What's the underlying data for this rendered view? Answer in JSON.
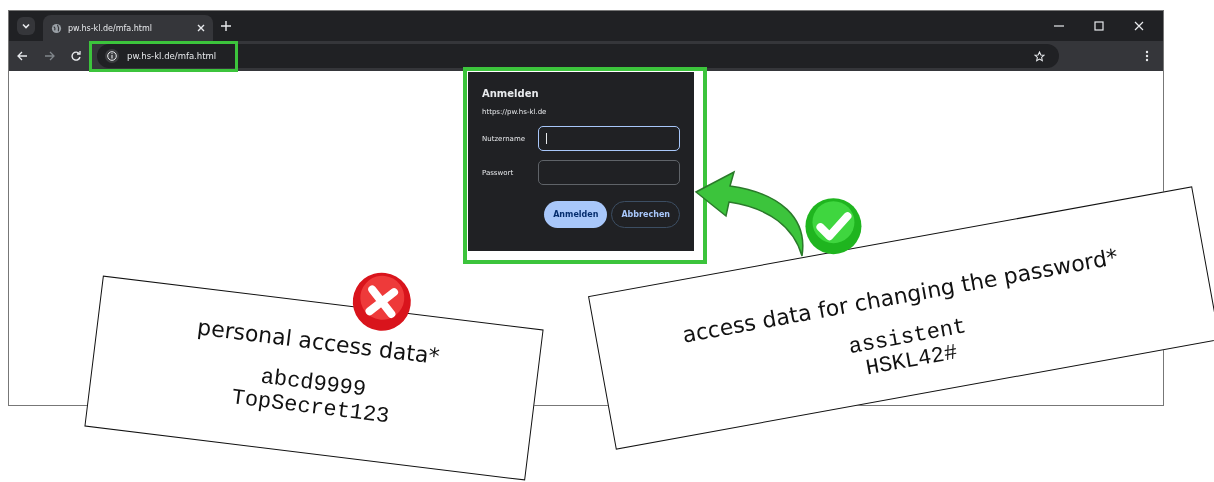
{
  "browser": {
    "tab": {
      "title": "pw.hs-kl.de/mfa.html"
    },
    "address": "pw.hs-kl.de/mfa.html"
  },
  "dialog": {
    "title": "Anmelden",
    "origin": "https://pw.hs-kl.de",
    "fields": [
      {
        "label": "Nutzername",
        "focused": true
      },
      {
        "label": "Passwort",
        "focused": false
      }
    ],
    "buttons": [
      {
        "label": "Anmelden",
        "kind": "primary"
      },
      {
        "label": "Abbrechen",
        "kind": "secondary"
      }
    ]
  },
  "annotations": [
    {
      "kind": "wrong",
      "heading": "personal access data*",
      "lines": [
        "abcd9999",
        "TopSecret123"
      ]
    },
    {
      "kind": "right",
      "heading": "access data for changing the password*",
      "lines": [
        "assistent",
        "HSKL42#"
      ]
    }
  ]
}
